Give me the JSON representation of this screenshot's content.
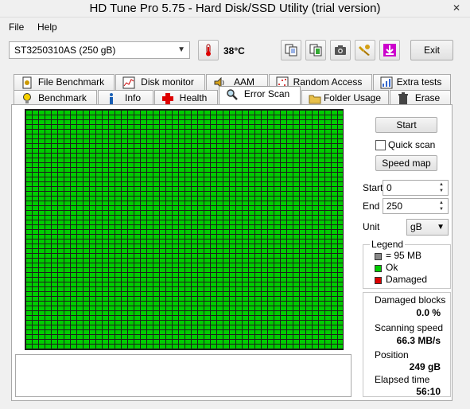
{
  "window": {
    "title": "HD Tune Pro 5.75 - Hard Disk/SSD Utility (trial version)",
    "close_glyph": "✕"
  },
  "menu": {
    "file": "File",
    "help": "Help"
  },
  "toolbar": {
    "drive": "ST3250310AS (250 gB)",
    "temperature": "38°C",
    "exit_label": "Exit"
  },
  "tabs_top": [
    "File Benchmark",
    "Disk monitor",
    "AAM",
    "Random Access",
    "Extra tests"
  ],
  "tabs_bottom": [
    "Benchmark",
    "Info",
    "Health",
    "Error Scan",
    "Folder Usage",
    "Erase"
  ],
  "active_tab": "Error Scan",
  "scan": {
    "start_button": "Start",
    "quick_scan_label": "Quick scan",
    "quick_scan_checked": false,
    "speed_map_button": "Speed map",
    "start_label": "Start",
    "start_value": "0",
    "end_label": "End",
    "end_value": "250",
    "unit_label": "Unit",
    "unit_value": "gB"
  },
  "legend": {
    "title": "Legend",
    "block_size": "= 95 MB",
    "ok": "Ok",
    "damaged": "Damaged"
  },
  "stats": {
    "damaged_blocks_label": "Damaged blocks",
    "damaged_blocks_value": "0.0 %",
    "scanning_speed_label": "Scanning speed",
    "scanning_speed_value": "66.3 MB/s",
    "position_label": "Position",
    "position_value": "249 gB",
    "elapsed_label": "Elapsed time",
    "elapsed_value": "56:10"
  },
  "colors": {
    "ok": "#00cc00",
    "damaged": "#dd0000",
    "block": "#888888",
    "grid_line": "#1d1d1d"
  }
}
